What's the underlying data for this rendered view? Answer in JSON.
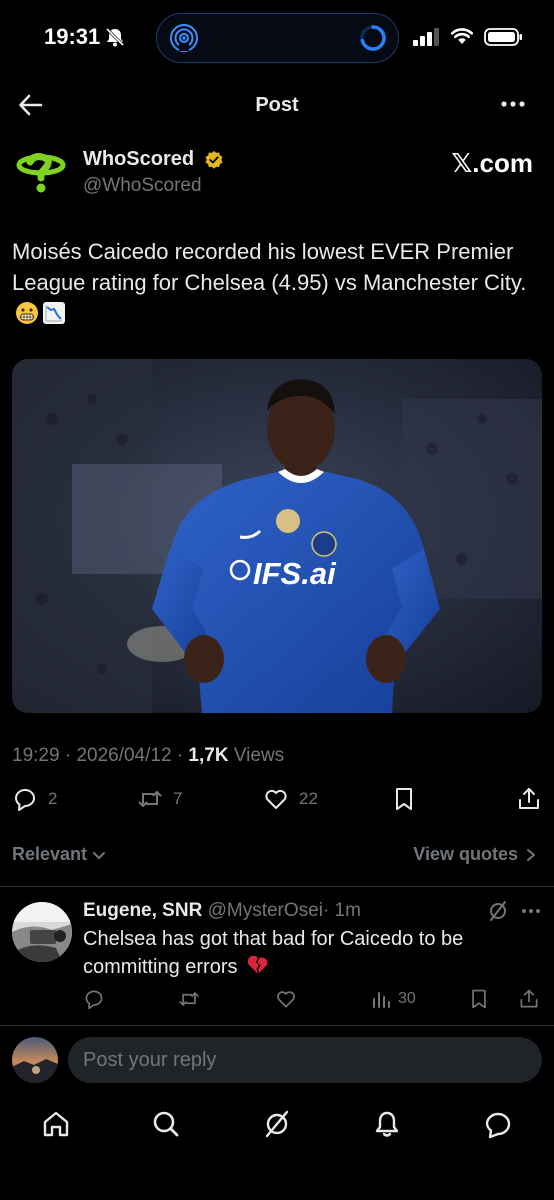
{
  "status_bar": {
    "time": "19:31"
  },
  "header": {
    "title": "Post"
  },
  "author": {
    "name": "WhoScored",
    "handle": "@WhoScored",
    "source": "𝕏.com"
  },
  "post": {
    "text": "Moisés Caicedo recorded his lowest EVER Premier League rating for Chelsea (4.95) vs Manchester City.",
    "emojis": [
      "grimacing-face",
      "chart-decreasing"
    ],
    "image_kit_text": "IFS.ai",
    "time": "19:29",
    "date": "2026/04/12",
    "views_count": "1,7K",
    "views_label": "Views"
  },
  "actions": {
    "replies": "2",
    "reposts": "7",
    "likes": "22"
  },
  "replies_header": {
    "sort_label": "Relevant",
    "view_quotes_label": "View quotes"
  },
  "reply": {
    "name": "Eugene, SNR",
    "handle": "@MysterOsei",
    "time": "· 1m",
    "text": "Chelsea has got that bad for Caicedo to be committing errors",
    "emoji": "broken-heart",
    "views": "30"
  },
  "composer": {
    "placeholder": "Post your reply"
  },
  "colors": {
    "background": "#000000",
    "text": "#e7e9ea",
    "muted": "#71767b",
    "verified": "#e2b719",
    "whoscored_green": "#7ed321",
    "chelsea_blue": "#1f4fb0"
  }
}
